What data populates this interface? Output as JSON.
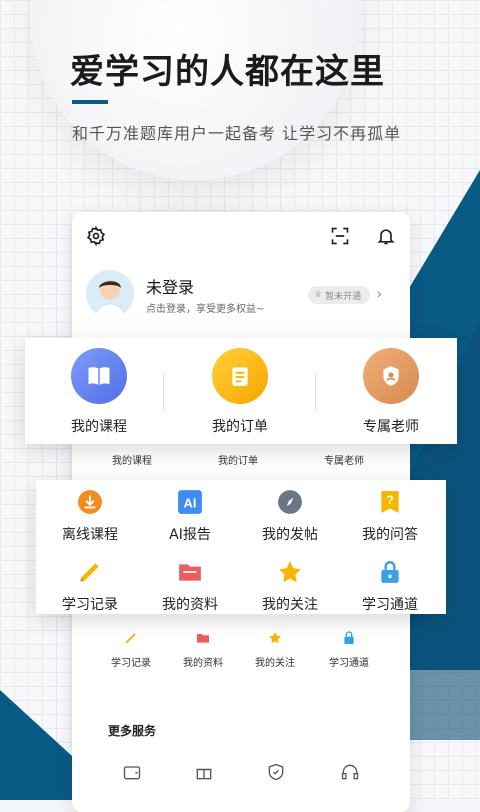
{
  "promo": {
    "headline": "爱学习的人都在这里",
    "subline": "和千万准题库用户一起备考 让学习不再孤单"
  },
  "colors": {
    "brand_blue": "#0a5a86",
    "accent_orange": "#f28c1e",
    "accent_blue": "#5d7ff0",
    "accent_yellow": "#f7b500"
  },
  "profile": {
    "name": "未登录",
    "hint": "点击登录，享受更多权益~",
    "vip_badge": "暂未开通"
  },
  "top_icons": [
    "settings-icon",
    "scan-icon",
    "bell-icon"
  ],
  "main_entries": [
    {
      "label": "我的课程",
      "icon": "book-icon"
    },
    {
      "label": "我的订单",
      "icon": "order-icon"
    },
    {
      "label": "专属老师",
      "icon": "teacher-icon"
    }
  ],
  "main_entries_ghost": [
    "我的课程",
    "我的订单",
    "专属老师"
  ],
  "grid_entries": [
    {
      "label": "离线课程",
      "icon": "download-icon"
    },
    {
      "label": "AI报告",
      "icon": "ai-icon"
    },
    {
      "label": "我的发帖",
      "icon": "compass-icon"
    },
    {
      "label": "我的问答",
      "icon": "question-icon"
    },
    {
      "label": "学习记录",
      "icon": "pencil-icon"
    },
    {
      "label": "我的资料",
      "icon": "folder-icon"
    },
    {
      "label": "我的关注",
      "icon": "star-icon"
    },
    {
      "label": "学习通道",
      "icon": "lock-icon"
    }
  ],
  "small_entries": [
    {
      "label": "学习记录"
    },
    {
      "label": "我的资料"
    },
    {
      "label": "我的关注"
    },
    {
      "label": "学习通道"
    }
  ],
  "more_services": {
    "title": "更多服务",
    "icons": [
      "wallet-icon",
      "gift-icon",
      "shield-icon",
      "headset-icon"
    ]
  }
}
